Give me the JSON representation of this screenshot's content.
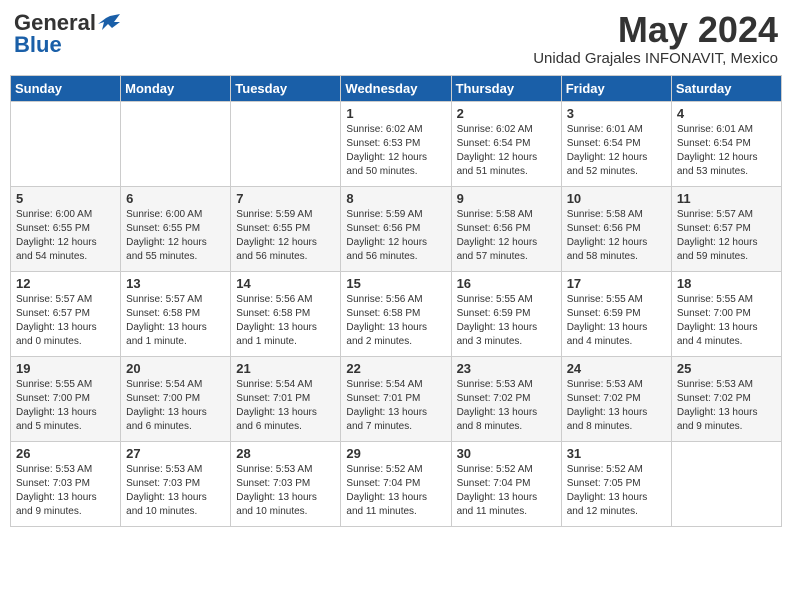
{
  "logo": {
    "general": "General",
    "blue": "Blue"
  },
  "title": "May 2024",
  "subtitle": "Unidad Grajales INFONAVIT, Mexico",
  "days_of_week": [
    "Sunday",
    "Monday",
    "Tuesday",
    "Wednesday",
    "Thursday",
    "Friday",
    "Saturday"
  ],
  "weeks": [
    [
      {
        "day": "",
        "info": ""
      },
      {
        "day": "",
        "info": ""
      },
      {
        "day": "",
        "info": ""
      },
      {
        "day": "1",
        "info": "Sunrise: 6:02 AM\nSunset: 6:53 PM\nDaylight: 12 hours\nand 50 minutes."
      },
      {
        "day": "2",
        "info": "Sunrise: 6:02 AM\nSunset: 6:54 PM\nDaylight: 12 hours\nand 51 minutes."
      },
      {
        "day": "3",
        "info": "Sunrise: 6:01 AM\nSunset: 6:54 PM\nDaylight: 12 hours\nand 52 minutes."
      },
      {
        "day": "4",
        "info": "Sunrise: 6:01 AM\nSunset: 6:54 PM\nDaylight: 12 hours\nand 53 minutes."
      }
    ],
    [
      {
        "day": "5",
        "info": "Sunrise: 6:00 AM\nSunset: 6:55 PM\nDaylight: 12 hours\nand 54 minutes."
      },
      {
        "day": "6",
        "info": "Sunrise: 6:00 AM\nSunset: 6:55 PM\nDaylight: 12 hours\nand 55 minutes."
      },
      {
        "day": "7",
        "info": "Sunrise: 5:59 AM\nSunset: 6:55 PM\nDaylight: 12 hours\nand 56 minutes."
      },
      {
        "day": "8",
        "info": "Sunrise: 5:59 AM\nSunset: 6:56 PM\nDaylight: 12 hours\nand 56 minutes."
      },
      {
        "day": "9",
        "info": "Sunrise: 5:58 AM\nSunset: 6:56 PM\nDaylight: 12 hours\nand 57 minutes."
      },
      {
        "day": "10",
        "info": "Sunrise: 5:58 AM\nSunset: 6:56 PM\nDaylight: 12 hours\nand 58 minutes."
      },
      {
        "day": "11",
        "info": "Sunrise: 5:57 AM\nSunset: 6:57 PM\nDaylight: 12 hours\nand 59 minutes."
      }
    ],
    [
      {
        "day": "12",
        "info": "Sunrise: 5:57 AM\nSunset: 6:57 PM\nDaylight: 13 hours\nand 0 minutes."
      },
      {
        "day": "13",
        "info": "Sunrise: 5:57 AM\nSunset: 6:58 PM\nDaylight: 13 hours\nand 1 minute."
      },
      {
        "day": "14",
        "info": "Sunrise: 5:56 AM\nSunset: 6:58 PM\nDaylight: 13 hours\nand 1 minute."
      },
      {
        "day": "15",
        "info": "Sunrise: 5:56 AM\nSunset: 6:58 PM\nDaylight: 13 hours\nand 2 minutes."
      },
      {
        "day": "16",
        "info": "Sunrise: 5:55 AM\nSunset: 6:59 PM\nDaylight: 13 hours\nand 3 minutes."
      },
      {
        "day": "17",
        "info": "Sunrise: 5:55 AM\nSunset: 6:59 PM\nDaylight: 13 hours\nand 4 minutes."
      },
      {
        "day": "18",
        "info": "Sunrise: 5:55 AM\nSunset: 7:00 PM\nDaylight: 13 hours\nand 4 minutes."
      }
    ],
    [
      {
        "day": "19",
        "info": "Sunrise: 5:55 AM\nSunset: 7:00 PM\nDaylight: 13 hours\nand 5 minutes."
      },
      {
        "day": "20",
        "info": "Sunrise: 5:54 AM\nSunset: 7:00 PM\nDaylight: 13 hours\nand 6 minutes."
      },
      {
        "day": "21",
        "info": "Sunrise: 5:54 AM\nSunset: 7:01 PM\nDaylight: 13 hours\nand 6 minutes."
      },
      {
        "day": "22",
        "info": "Sunrise: 5:54 AM\nSunset: 7:01 PM\nDaylight: 13 hours\nand 7 minutes."
      },
      {
        "day": "23",
        "info": "Sunrise: 5:53 AM\nSunset: 7:02 PM\nDaylight: 13 hours\nand 8 minutes."
      },
      {
        "day": "24",
        "info": "Sunrise: 5:53 AM\nSunset: 7:02 PM\nDaylight: 13 hours\nand 8 minutes."
      },
      {
        "day": "25",
        "info": "Sunrise: 5:53 AM\nSunset: 7:02 PM\nDaylight: 13 hours\nand 9 minutes."
      }
    ],
    [
      {
        "day": "26",
        "info": "Sunrise: 5:53 AM\nSunset: 7:03 PM\nDaylight: 13 hours\nand 9 minutes."
      },
      {
        "day": "27",
        "info": "Sunrise: 5:53 AM\nSunset: 7:03 PM\nDaylight: 13 hours\nand 10 minutes."
      },
      {
        "day": "28",
        "info": "Sunrise: 5:53 AM\nSunset: 7:03 PM\nDaylight: 13 hours\nand 10 minutes."
      },
      {
        "day": "29",
        "info": "Sunrise: 5:52 AM\nSunset: 7:04 PM\nDaylight: 13 hours\nand 11 minutes."
      },
      {
        "day": "30",
        "info": "Sunrise: 5:52 AM\nSunset: 7:04 PM\nDaylight: 13 hours\nand 11 minutes."
      },
      {
        "day": "31",
        "info": "Sunrise: 5:52 AM\nSunset: 7:05 PM\nDaylight: 13 hours\nand 12 minutes."
      },
      {
        "day": "",
        "info": ""
      }
    ]
  ]
}
